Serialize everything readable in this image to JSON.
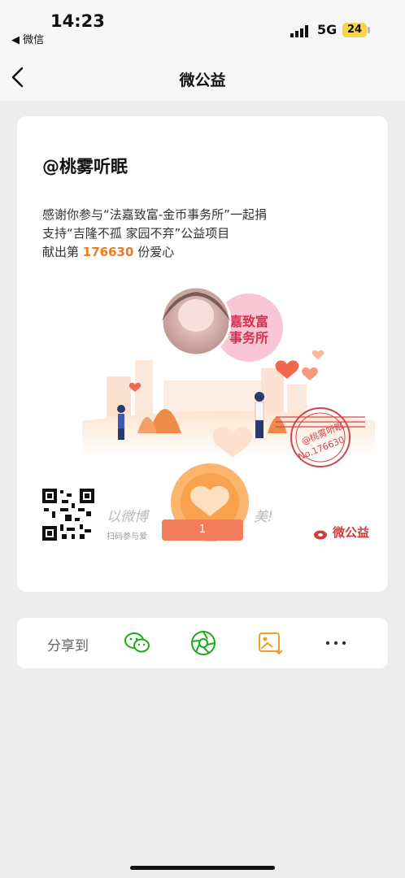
{
  "status_bar": {
    "time": "14:23",
    "back_app": "◀ 微信",
    "network": "5G",
    "battery": "24"
  },
  "nav": {
    "title": "微公益"
  },
  "card": {
    "username": "@桃雾听眠",
    "thanks_line1": "感谢你参与“法嘉致富-金币事务所”一起捐",
    "thanks_line2": "支持“吉隆不孤 家园不弃”公益项目",
    "thanks_line3_prefix": "献出第",
    "love_count": "176630",
    "thanks_line3_suffix": "份爱心",
    "badge_line1": "嘉致富",
    "badge_line2": "事务所",
    "stamp_name": "@桃雾听眠",
    "stamp_no": "No.176630",
    "slogan": "以微博",
    "slogan_end": "美!",
    "scan_hint": "扫码参与爱",
    "token_label": "1",
    "brand": "微公益",
    "brand_url": "gongyi.weibo.com"
  },
  "share": {
    "label": "分享到",
    "icons": [
      "wechat-icon",
      "moments-icon",
      "save-image-icon",
      "more-icon"
    ]
  },
  "colors": {
    "accent": "#f07a1e",
    "wechat_green": "#1aad19",
    "stamp_red": "#d2454f"
  }
}
